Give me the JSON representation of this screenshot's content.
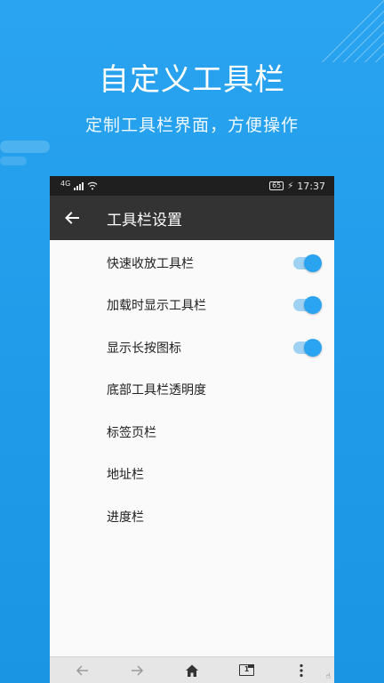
{
  "hero": {
    "title": "自定义工具栏",
    "subtitle": "定制工具栏界面，方便操作"
  },
  "statusbar": {
    "network": "4G",
    "battery": "65",
    "time": "17:37"
  },
  "toolbar": {
    "back_icon": "arrow-left-icon",
    "title": "工具栏设置"
  },
  "settings": [
    {
      "label": "快速收放工具栏",
      "toggle": true,
      "on": true
    },
    {
      "label": "加载时显示工具栏",
      "toggle": true,
      "on": true
    },
    {
      "label": "显示长按图标",
      "toggle": true,
      "on": true
    },
    {
      "label": "底部工具栏透明度",
      "toggle": false
    },
    {
      "label": "标签页栏",
      "toggle": false
    },
    {
      "label": "地址栏",
      "toggle": false
    },
    {
      "label": "进度栏",
      "toggle": false
    }
  ],
  "bottom_nav": {
    "tabs_count": "1",
    "icons": [
      "back-arrow-icon",
      "forward-arrow-icon",
      "home-icon",
      "tabs-icon",
      "more-vertical-icon"
    ]
  },
  "colors": {
    "accent": "#2aa4f0",
    "toolbar_bg": "#333333",
    "statusbar_bg": "#1f1f1f",
    "page_bg": "#fafafa"
  }
}
